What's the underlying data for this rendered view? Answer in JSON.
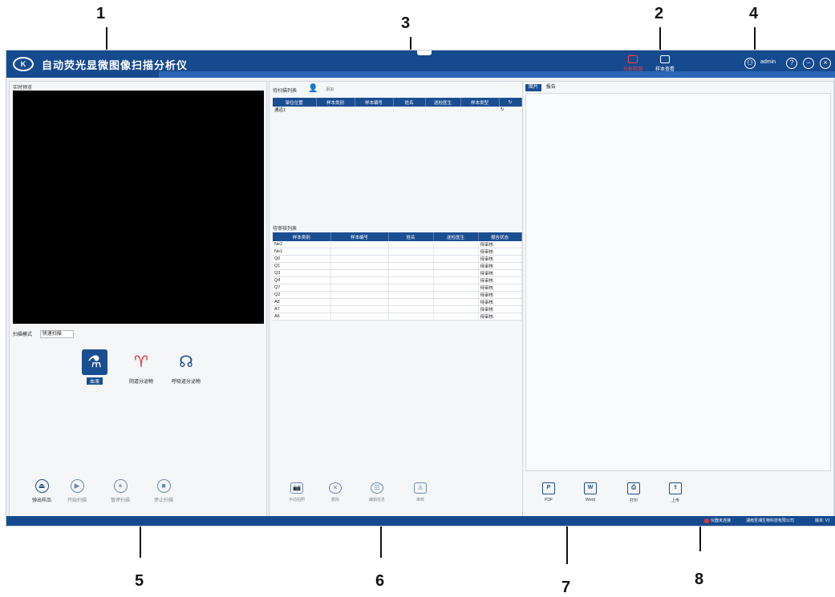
{
  "callouts": [
    "1",
    "2",
    "3",
    "4",
    "5",
    "6",
    "7",
    "8"
  ],
  "app": {
    "logo_text": "K",
    "title": "自动荧光显微图像扫描分析仪",
    "header_buttons": [
      {
        "label": "分析检测",
        "icon": "analysis-icon",
        "active": true
      },
      {
        "label": "样本查看",
        "icon": "sample-view-icon",
        "active": false
      }
    ],
    "user": "admin",
    "window_controls": {
      "help": "?",
      "minimize": "−",
      "close": "×"
    }
  },
  "left": {
    "preview_label": "实时预览",
    "mode_label": "扫描模式",
    "mode_value": "快速扫描",
    "sample_types": [
      {
        "label": "血液",
        "glyph": "⚗",
        "active": true
      },
      {
        "label": "阴道分泌物",
        "glyph": "♈",
        "active": false
      },
      {
        "label": "呼吸道分泌物",
        "glyph": "☊",
        "active": false
      }
    ],
    "controls": [
      {
        "label": "弹出样品",
        "glyph": "⏏"
      },
      {
        "label": "开始扫描",
        "glyph": "▶"
      },
      {
        "label": "暂停扫描",
        "glyph": "⏸"
      },
      {
        "label": "停止扫描",
        "glyph": "■"
      }
    ]
  },
  "middle": {
    "scan_queue_label": "待扫描列表",
    "patient_hint": "添加",
    "scan_table": {
      "headers": [
        "架位位置",
        "样本类别",
        "样本编号",
        "姓名",
        "送检医生",
        "样本类型",
        "↻"
      ],
      "rows": [
        [
          "通道1",
          "",
          "",
          "",
          "",
          "",
          "↻"
        ]
      ]
    },
    "review_label": "待审核列表",
    "review_table": {
      "headers": [
        "样本类别",
        "样本编号",
        "姓名",
        "送检医生",
        "报告状态"
      ],
      "rows": [
        [
          "Ne2",
          "",
          "",
          "",
          "待审核"
        ],
        [
          "Ne1",
          "",
          "",
          "",
          "待审核"
        ],
        [
          "Q0",
          "",
          "",
          "",
          "待审核"
        ],
        [
          "Q1",
          "",
          "",
          "",
          "待审核"
        ],
        [
          "Q3",
          "",
          "",
          "",
          "待审核"
        ],
        [
          "Q4",
          "",
          "",
          "",
          "待审核"
        ],
        [
          "Q7",
          "",
          "",
          "",
          "待审核"
        ],
        [
          "Q2",
          "",
          "",
          "",
          "待审核"
        ],
        [
          "A8",
          "",
          "",
          "",
          "待审核"
        ],
        [
          "A7",
          "",
          "",
          "",
          "待审核"
        ],
        [
          "A6",
          "",
          "",
          "",
          "待审核"
        ]
      ]
    },
    "tools": [
      {
        "label": "手动拍照",
        "glyph": "📷"
      },
      {
        "label": "删除",
        "glyph": "✕"
      },
      {
        "label": "编辑信息",
        "glyph": "☰"
      },
      {
        "label": "审核",
        "glyph": "♙"
      }
    ]
  },
  "right": {
    "tabs": [
      "图片",
      "报告"
    ],
    "exports": [
      {
        "label": "PDF",
        "glyph": "P"
      },
      {
        "label": "Word",
        "glyph": "W"
      },
      {
        "label": "打印",
        "glyph": "⎙"
      },
      {
        "label": "上传",
        "glyph": "⇪"
      }
    ]
  },
  "status": {
    "connection": "仪器未连接",
    "company": "湖南圣湘生物科技有限公司",
    "version": "版本: V1"
  }
}
